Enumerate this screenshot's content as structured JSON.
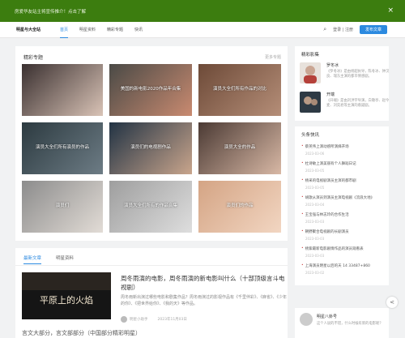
{
  "topbar": {
    "notice": "房爱华友站主将宣传推介！点击了解",
    "close_icon": "×"
  },
  "header": {
    "logo": "明星与大全站",
    "nav": [
      {
        "label": "首页",
        "active": true
      },
      {
        "label": "明星资料",
        "active": false
      },
      {
        "label": "精彩专题",
        "active": false
      },
      {
        "label": "快讯",
        "active": false
      }
    ],
    "search_icon": "⌕",
    "login": "登录 | 注册",
    "post_button": "发布文章"
  },
  "special": {
    "title": "精彩专题",
    "more": "更多专题",
    "tiles": [
      {
        "caption": "",
        "colors": [
          "#3a3030",
          "#d9c3b6"
        ]
      },
      {
        "caption": "美国的新电影2020作品年合集",
        "colors": [
          "#4a4a46",
          "#c98a70"
        ]
      },
      {
        "caption": "演员大全们所有作品的对比",
        "colors": [
          "#6d4a38",
          "#b58e78"
        ]
      },
      {
        "caption": "演员大全们所有演员的作品",
        "colors": [
          "#2c3a40",
          "#6d7c85"
        ]
      },
      {
        "caption": "演员们的电视剧作品",
        "colors": [
          "#223344",
          "#c9a58c"
        ]
      },
      {
        "caption": "演员大全的作品",
        "colors": [
          "#4b3a34",
          "#d8b8a5"
        ]
      },
      {
        "caption": "演员们",
        "colors": [
          "#8c8c8c",
          "#e2dcd6"
        ]
      },
      {
        "caption": "演员大全们所有的作品合集",
        "colors": [
          "#9e9e9e",
          "#dedede"
        ]
      },
      {
        "caption": "演员们的作品",
        "colors": [
          "#d4a484",
          "#f2d6c2"
        ]
      }
    ]
  },
  "articles": {
    "tabs": [
      "最新文章",
      "明星资料"
    ],
    "first": {
      "title": "周冬雨演的电影，周冬雨演的新电影叫什么（十部顶级言斗电视剧）",
      "summary": "周冬雨新出演过哪些电影和剧集作品？周冬雨演过的影视作品有《千里伴彩》、《麻雀》、《少年的你》、《把世界给你》、《我的天》等作品。",
      "author": "明星小助手",
      "date": "2023年11月03日",
      "thumb_text": "平原上的火焰"
    },
    "next_title": "言文大部分，言文部部分（中国部分精彩明星）"
  },
  "sidebar": {
    "featured_title": "精彩影集",
    "featured": [
      {
        "name": "罗冬冰",
        "desc": "《罗冬冰》是由杨超执导，陈冬冰、钟汉良、瑞东主演的都市情感剧。"
      },
      {
        "name": "开端",
        "desc": "《开端》是由刘洪宇导演，白敬亭、赵今麦、刘奕君等主演的悬疑剧。"
      }
    ],
    "news_title": "头条快讯",
    "news": [
      {
        "title": "蔡英伟上演动感所演绎开场",
        "date": "2023-03-06"
      },
      {
        "title": "杜诗敏上演美丽有个人舞蹈日记",
        "date": "2023-03-05"
      },
      {
        "title": "杨采的电视剧演员主演的都市剧",
        "date": "2023-03-05"
      },
      {
        "title": "胡歌从演员到演员主演电视剧《流浪大地》",
        "date": "2023-03-04"
      },
      {
        "title": "王宝强与林志玲的合作生活",
        "date": "2023-03-03"
      },
      {
        "title": "朝野聚合电视剧的长剧演员",
        "date": "2023-03-03"
      },
      {
        "title": "杨紫最新电影剧情作品的演员观看表",
        "date": "2023-03-03"
      },
      {
        "title": "上海演员明星以后的天 14 33487+860",
        "date": "2023-03-02"
      }
    ],
    "comment": {
      "name": "明星八卦号",
      "text": "这个人说的不错，什么时候有新的电影呢？"
    }
  },
  "share_icon": "<"
}
